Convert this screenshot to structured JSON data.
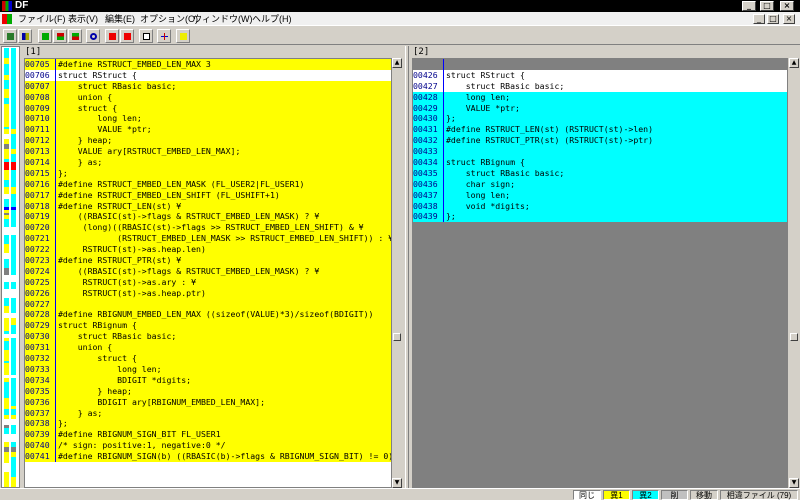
{
  "window": {
    "title": "DF",
    "controls": [
      "_",
      "□",
      "×"
    ]
  },
  "menu": {
    "items": [
      "ファイル(F)",
      "表示(V)",
      "編集(E)",
      "オプション(O)",
      "ウィンドウ(W)",
      "ヘルプ(H)"
    ],
    "mdi_controls": [
      "_",
      "□",
      "×"
    ]
  },
  "toolbar": {
    "icons": [
      "new-compare-icon",
      "open-icon",
      "first-diff-icon",
      "prev-diff-icon",
      "next-diff-icon",
      "refresh-icon",
      "up-red-icon",
      "down-red-icon",
      "copy-icon",
      "sync-icon",
      "help-icon"
    ]
  },
  "colors": {
    "diff_file1": "#ffff00",
    "diff_file2": "#00ffff",
    "common": "#ffffff",
    "gap": "#808080",
    "line_number": "#00008b"
  },
  "pane1": {
    "label": "[1]",
    "lines": [
      {
        "n": "00705",
        "t": "#define RSTRUCT_EMBED_LEN_MAX 3",
        "s": "diff1"
      },
      {
        "n": "00706",
        "t": "struct RStruct {",
        "s": "common"
      },
      {
        "n": "00707",
        "t": "    struct RBasic basic;",
        "s": "diff1"
      },
      {
        "n": "00708",
        "t": "    union {",
        "s": "diff1"
      },
      {
        "n": "00709",
        "t": "    struct {",
        "s": "diff1"
      },
      {
        "n": "00710",
        "t": "        long len;",
        "s": "diff1"
      },
      {
        "n": "00711",
        "t": "        VALUE *ptr;",
        "s": "diff1"
      },
      {
        "n": "00712",
        "t": "    } heap;",
        "s": "diff1"
      },
      {
        "n": "00713",
        "t": "    VALUE ary[RSTRUCT_EMBED_LEN_MAX];",
        "s": "diff1"
      },
      {
        "n": "00714",
        "t": "    } as;",
        "s": "diff1"
      },
      {
        "n": "00715",
        "t": "};",
        "s": "diff1"
      },
      {
        "n": "00716",
        "t": "#define RSTRUCT_EMBED_LEN_MASK (FL_USER2|FL_USER1)",
        "s": "diff1"
      },
      {
        "n": "00717",
        "t": "#define RSTRUCT_EMBED_LEN_SHIFT (FL_USHIFT+1)",
        "s": "diff1"
      },
      {
        "n": "00718",
        "t": "#define RSTRUCT_LEN(st) ¥",
        "s": "diff1"
      },
      {
        "n": "00719",
        "t": "    ((RBASIC(st)->flags & RSTRUCT_EMBED_LEN_MASK) ? ¥",
        "s": "diff1"
      },
      {
        "n": "00720",
        "t": "     (long)((RBASIC(st)->flags >> RSTRUCT_EMBED_LEN_SHIFT) & ¥",
        "s": "diff1"
      },
      {
        "n": "00721",
        "t": "            (RSTRUCT_EMBED_LEN_MASK >> RSTRUCT_EMBED_LEN_SHIFT)) : ¥",
        "s": "diff1"
      },
      {
        "n": "00722",
        "t": "     RSTRUCT(st)->as.heap.len)",
        "s": "diff1"
      },
      {
        "n": "00723",
        "t": "#define RSTRUCT_PTR(st) ¥",
        "s": "diff1"
      },
      {
        "n": "00724",
        "t": "    ((RBASIC(st)->flags & RSTRUCT_EMBED_LEN_MASK) ? ¥",
        "s": "diff1"
      },
      {
        "n": "00725",
        "t": "     RSTRUCT(st)->as.ary : ¥",
        "s": "diff1"
      },
      {
        "n": "00726",
        "t": "     RSTRUCT(st)->as.heap.ptr)",
        "s": "diff1"
      },
      {
        "n": "00727",
        "t": "",
        "s": "diff1"
      },
      {
        "n": "00728",
        "t": "#define RBIGNUM_EMBED_LEN_MAX ((sizeof(VALUE)*3)/sizeof(BDIGIT))",
        "s": "diff1"
      },
      {
        "n": "00729",
        "t": "struct RBignum {",
        "s": "diff1"
      },
      {
        "n": "00730",
        "t": "    struct RBasic basic;",
        "s": "diff1"
      },
      {
        "n": "00731",
        "t": "    union {",
        "s": "diff1"
      },
      {
        "n": "00732",
        "t": "        struct {",
        "s": "diff1"
      },
      {
        "n": "00733",
        "t": "            long len;",
        "s": "diff1"
      },
      {
        "n": "00734",
        "t": "            BDIGIT *digits;",
        "s": "diff1"
      },
      {
        "n": "00735",
        "t": "        } heap;",
        "s": "diff1"
      },
      {
        "n": "00736",
        "t": "        BDIGIT ary[RBIGNUM_EMBED_LEN_MAX];",
        "s": "diff1"
      },
      {
        "n": "00737",
        "t": "    } as;",
        "s": "diff1"
      },
      {
        "n": "00738",
        "t": "};",
        "s": "diff1"
      },
      {
        "n": "00739",
        "t": "#define RBIGNUM_SIGN_BIT FL_USER1",
        "s": "diff1"
      },
      {
        "n": "00740",
        "t": "/* sign: positive:1, negative:0 */",
        "s": "diff1"
      },
      {
        "n": "00741",
        "t": "#define RBIGNUM_SIGN(b) ((RBASIC(b)->flags & RBIGNUM_SIGN_BIT) != 0)",
        "s": "diff1"
      }
    ]
  },
  "pane2": {
    "label": "[2]",
    "lines": [
      {
        "n": "",
        "t": "",
        "s": "gap"
      },
      {
        "n": "00426",
        "t": "struct RStruct {",
        "s": "common"
      },
      {
        "n": "00427",
        "t": "    struct RBasic basic;",
        "s": "common"
      },
      {
        "n": "00428",
        "t": "    long len;",
        "s": "diff2"
      },
      {
        "n": "00429",
        "t": "    VALUE *ptr;",
        "s": "diff2"
      },
      {
        "n": "00430",
        "t": "};",
        "s": "diff2"
      },
      {
        "n": "00431",
        "t": "#define RSTRUCT_LEN(st) (RSTRUCT(st)->len)",
        "s": "diff2"
      },
      {
        "n": "00432",
        "t": "#define RSTRUCT_PTR(st) (RSTRUCT(st)->ptr)",
        "s": "diff2"
      },
      {
        "n": "00433",
        "t": "",
        "s": "diff2"
      },
      {
        "n": "00434",
        "t": "struct RBignum {",
        "s": "diff2"
      },
      {
        "n": "00435",
        "t": "    struct RBasic basic;",
        "s": "diff2"
      },
      {
        "n": "00436",
        "t": "    char sign;",
        "s": "diff2"
      },
      {
        "n": "00437",
        "t": "    long len;",
        "s": "diff2"
      },
      {
        "n": "00438",
        "t": "    void *digits;",
        "s": "diff2"
      },
      {
        "n": "00439",
        "t": "};",
        "s": "diff2"
      }
    ]
  },
  "status": {
    "same": "同じ",
    "diff1": "異1",
    "diff2": "異2",
    "deleted": "削",
    "moved": "移動",
    "compare_file": "相違ファイル (79)"
  }
}
